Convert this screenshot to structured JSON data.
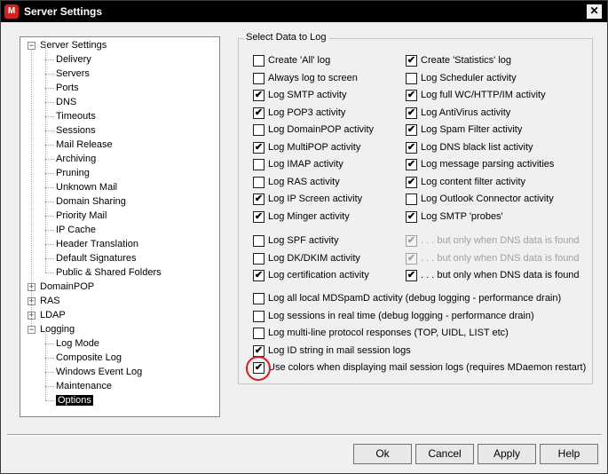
{
  "window": {
    "title": "Server Settings",
    "close_glyph": "✕"
  },
  "tree": {
    "items": [
      {
        "label": "Server Settings",
        "expander": "−"
      },
      {
        "label": "Delivery"
      },
      {
        "label": "Servers"
      },
      {
        "label": "Ports"
      },
      {
        "label": "DNS"
      },
      {
        "label": "Timeouts"
      },
      {
        "label": "Sessions"
      },
      {
        "label": "Mail Release"
      },
      {
        "label": "Archiving"
      },
      {
        "label": "Pruning"
      },
      {
        "label": "Unknown Mail"
      },
      {
        "label": "Domain Sharing"
      },
      {
        "label": "Priority Mail"
      },
      {
        "label": "IP Cache"
      },
      {
        "label": "Header Translation"
      },
      {
        "label": "Default Signatures"
      },
      {
        "label": "Public & Shared Folders"
      },
      {
        "label": "DomainPOP",
        "expander": "+"
      },
      {
        "label": "RAS",
        "expander": "+"
      },
      {
        "label": "LDAP",
        "expander": "+"
      },
      {
        "label": "Logging",
        "expander": "−"
      },
      {
        "label": "Log Mode"
      },
      {
        "label": "Composite Log"
      },
      {
        "label": "Windows Event Log"
      },
      {
        "label": "Maintenance"
      },
      {
        "label": "Options",
        "selected": true
      }
    ]
  },
  "group": {
    "title": "Select Data to Log"
  },
  "left_options": [
    {
      "label": "Create 'All' log",
      "checked": false
    },
    {
      "label": "Always log to screen",
      "checked": false
    },
    {
      "label": "Log SMTP activity",
      "checked": true
    },
    {
      "label": "Log POP3 activity",
      "checked": true
    },
    {
      "label": "Log DomainPOP activity",
      "checked": false
    },
    {
      "label": "Log MultiPOP activity",
      "checked": true
    },
    {
      "label": "Log IMAP activity",
      "checked": false
    },
    {
      "label": "Log RAS activity",
      "checked": false
    },
    {
      "label": "Log IP Screen activity",
      "checked": true
    },
    {
      "label": "Log Minger activity",
      "checked": true
    }
  ],
  "right_options": [
    {
      "label": "Create 'Statistics' log",
      "checked": true
    },
    {
      "label": "Log Scheduler activity",
      "checked": false
    },
    {
      "label": "Log full WC/HTTP/IM activity",
      "checked": true
    },
    {
      "label": "Log AntiVirus activity",
      "checked": true
    },
    {
      "label": "Log Spam Filter activity",
      "checked": true
    },
    {
      "label": "Log DNS black list activity",
      "checked": true
    },
    {
      "label": "Log message parsing activities",
      "checked": true
    },
    {
      "label": "Log content filter activity",
      "checked": true
    },
    {
      "label": "Log Outlook Connector activity",
      "checked": false
    },
    {
      "label": "Log SMTP 'probes'",
      "checked": true
    }
  ],
  "auth_options": [
    {
      "label": "Log SPF activity",
      "checked": false
    },
    {
      "label": "Log DK/DKIM activity",
      "checked": false
    },
    {
      "label": "Log certification activity",
      "checked": true
    }
  ],
  "dns_options": [
    {
      "label": ". . . but only when DNS data is found",
      "checked": true,
      "disabled": true
    },
    {
      "label": ". . . but only when DNS data is found",
      "checked": true,
      "disabled": true
    },
    {
      "label": ". . . but only when DNS data is found",
      "checked": true,
      "disabled": false
    }
  ],
  "bottom_options": [
    {
      "label": "Log all local MDSpamD activity (debug logging - performance drain)",
      "checked": false
    },
    {
      "label": "Log sessions in real time (debug logging - performance drain)",
      "checked": false
    },
    {
      "label": "Log multi-line protocol responses (TOP, UIDL, LIST etc)",
      "checked": false
    },
    {
      "label": "Log ID string in mail session logs",
      "checked": true
    },
    {
      "label": "Use colors when displaying mail session logs (requires MDaemon restart)",
      "checked": true
    }
  ],
  "buttons": {
    "ok": "Ok",
    "cancel": "Cancel",
    "apply": "Apply",
    "help": "Help"
  },
  "check_glyph": "✔"
}
